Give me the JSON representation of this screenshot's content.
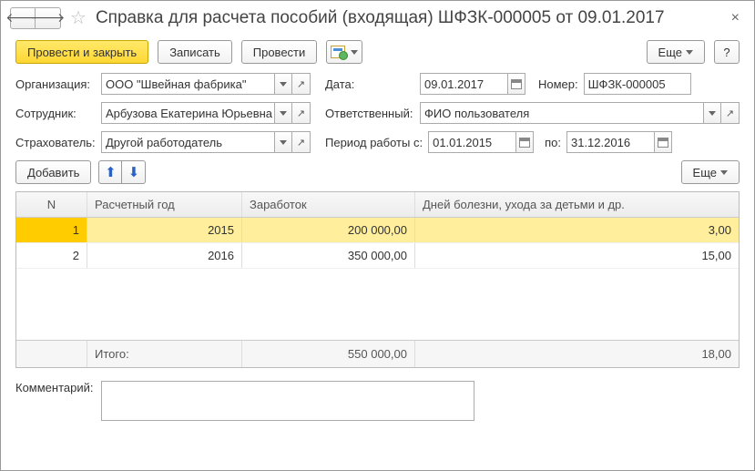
{
  "header": {
    "title": "Справка для расчета пособий (входящая) ШФЗК-000005 от 09.01.2017"
  },
  "toolbar": {
    "post_close": "Провести и закрыть",
    "save": "Записать",
    "post": "Провести",
    "more": "Еще",
    "help": "?"
  },
  "fields": {
    "org_label": "Организация:",
    "org_value": "ООО \"Швейная фабрика\"",
    "date_label": "Дата:",
    "date_value": "09.01.2017",
    "num_label": "Номер:",
    "num_value": "ШФЗК-000005",
    "emp_label": "Сотрудник:",
    "emp_value": "Арбузова Екатерина Юрьевна",
    "resp_label": "Ответственный:",
    "resp_value": "ФИО пользователя",
    "ins_label": "Страхователь:",
    "ins_value": "Другой работодатель",
    "period_label": "Период работы с:",
    "period_from": "01.01.2015",
    "period_to_label": "по:",
    "period_to": "31.12.2016"
  },
  "tableToolbar": {
    "add": "Добавить",
    "more": "Еще"
  },
  "table": {
    "headers": {
      "n": "N",
      "year": "Расчетный год",
      "earn": "Заработок",
      "days": "Дней болезни, ухода за детьми и др."
    },
    "rows": [
      {
        "n": "1",
        "year": "2015",
        "earn": "200 000,00",
        "days": "3,00"
      },
      {
        "n": "2",
        "year": "2016",
        "earn": "350 000,00",
        "days": "15,00"
      }
    ],
    "footer": {
      "label": "Итого:",
      "earn": "550 000,00",
      "days": "18,00"
    }
  },
  "comment_label": "Комментарий:"
}
